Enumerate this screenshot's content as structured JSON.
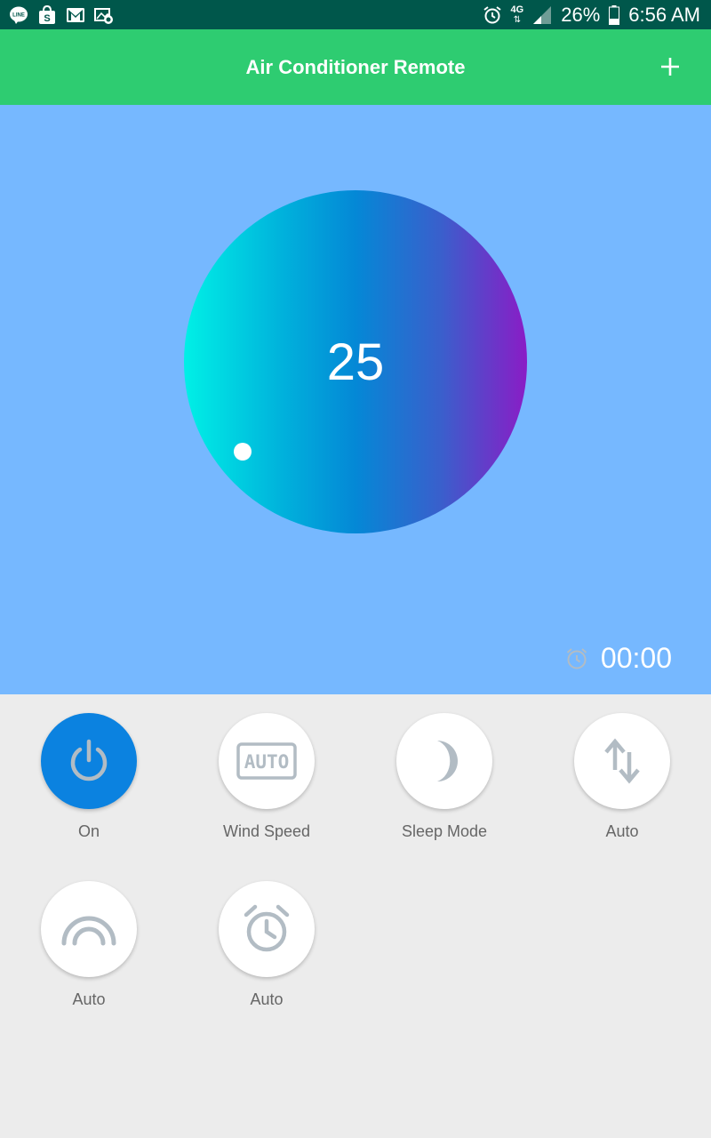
{
  "statusbar": {
    "battery": "26%",
    "time": "6:56 AM",
    "network": "4G",
    "icons": [
      "line-icon",
      "shopping-bag-icon",
      "gmail-icon",
      "gallery-icon",
      "alarm-icon",
      "signal-icon",
      "battery-icon"
    ]
  },
  "appbar": {
    "title": "Air Conditioner Remote",
    "add_icon": "plus-icon"
  },
  "display": {
    "temperature": "25",
    "timer": "00:00",
    "timer_icon": "alarm-clock-icon"
  },
  "colors": {
    "statusbar": "#00574b",
    "appbar": "#2ecc71",
    "panel": "#76b8ff",
    "dial_start": "#00f0e6",
    "dial_mid": "#0488d6",
    "dial_end": "#8a1cc6",
    "active_button": "#0b82e0",
    "icon_gray": "#b2bcc4"
  },
  "controls": [
    {
      "label": "On",
      "icon": "power-icon",
      "active": true
    },
    {
      "label": "Wind Speed",
      "icon": "auto-badge-icon",
      "active": false
    },
    {
      "label": "Sleep Mode",
      "icon": "moon-icon",
      "active": false
    },
    {
      "label": "Auto",
      "icon": "up-down-arrows-icon",
      "active": false
    },
    {
      "label": "Auto",
      "icon": "swing-arc-icon",
      "active": false
    },
    {
      "label": "Auto",
      "icon": "alarm-clock-icon",
      "active": false
    }
  ]
}
